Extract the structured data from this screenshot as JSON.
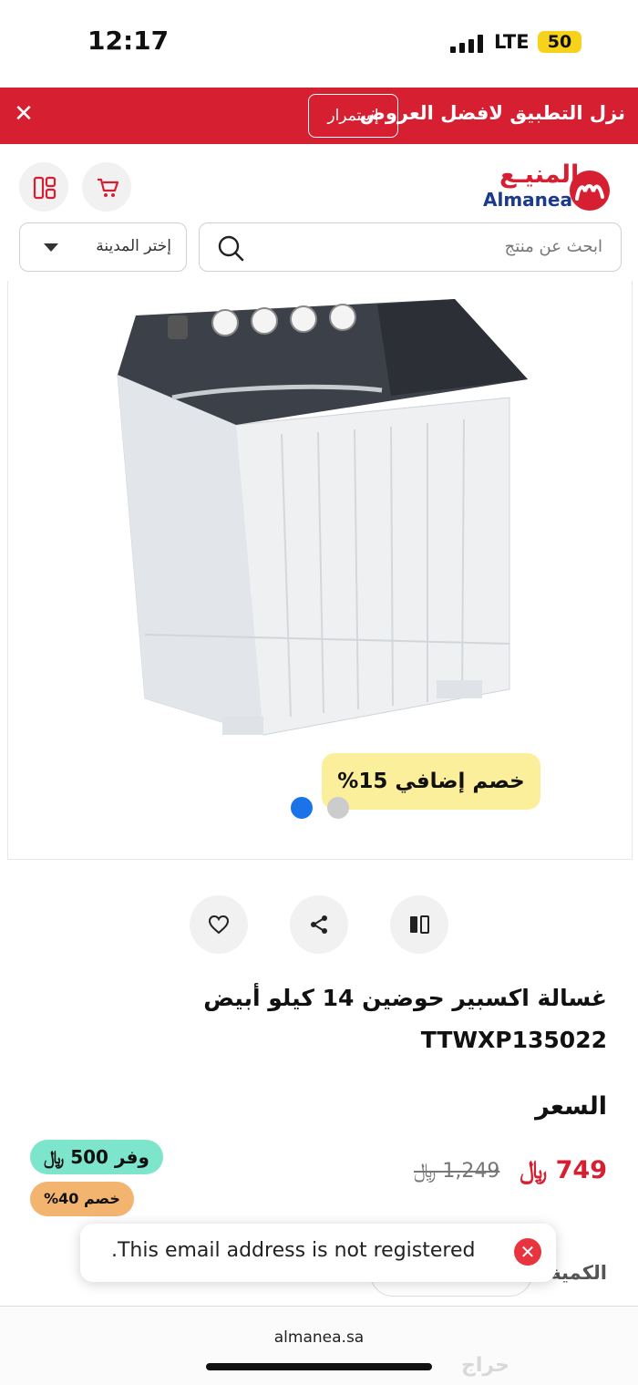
{
  "status_bar": {
    "time": "12:17",
    "network": "LTE",
    "battery": "50"
  },
  "app_banner": {
    "text": "نزل التطبيق لافضل العروض",
    "continue_label": "إستمرار",
    "close_icon": "close-icon"
  },
  "header": {
    "logo_ar": "المنيـع",
    "logo_en": "Almanea",
    "cart_icon": "cart-icon",
    "menu_icon": "categories-icon",
    "city_select": {
      "label": "إختر المدينة"
    },
    "search": {
      "placeholder": "ابحث عن منتج"
    }
  },
  "gallery": {
    "promo": "%خصم إضافي 15",
    "total_images": 2,
    "active_index": 1,
    "dot_colors": {
      "active": "#1a73e8",
      "inactive": "#cccccc"
    }
  },
  "actions": {
    "compare_icon": "compare-icon",
    "share_icon": "share-icon",
    "wishlist_icon": "heart-icon"
  },
  "product": {
    "title": "غسالة اكسبير حوضين 14 كيلو أبيض",
    "sku": "TTWXP135022",
    "price_label": "السعر",
    "price_now": "749 ﷼",
    "price_old": "1,249 ﷼",
    "save_badge": "وفر 500 ﷼",
    "discount_badge": "خصم 40%",
    "quantity_label": "الكمية"
  },
  "toast": {
    "message": ".This email address is not registered"
  },
  "browser": {
    "url": "almanea.sa"
  },
  "watermark": "حراج",
  "colors": {
    "brand_red": "#d62032",
    "brand_blue": "#1a3a8c",
    "promo_yellow": "#fbef9b",
    "save_green": "#7de5cc",
    "discount_orange": "#f2b46f"
  }
}
